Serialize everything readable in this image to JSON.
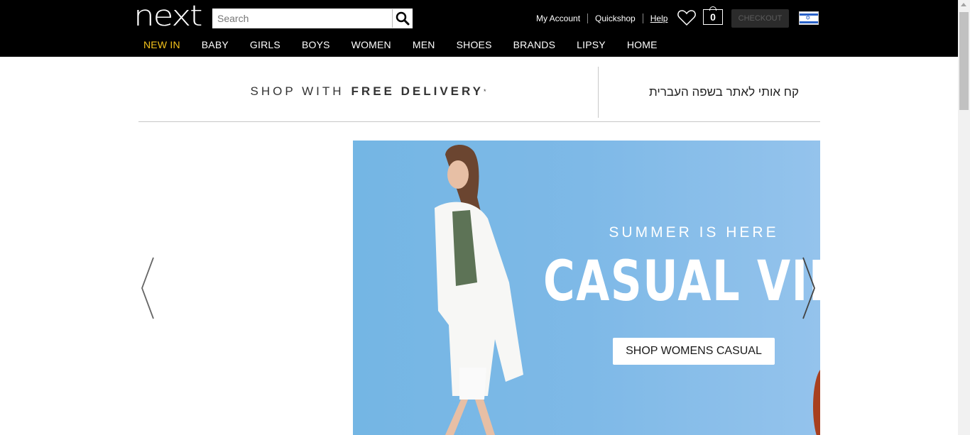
{
  "header": {
    "logo_text": "next",
    "search_placeholder": "Search",
    "links": [
      {
        "label": "My Account"
      },
      {
        "label": "Quickshop"
      },
      {
        "label": "Help"
      }
    ],
    "bag_count": "0",
    "checkout_label": "CHECKOUT",
    "flag": "israel-flag"
  },
  "nav": {
    "items": [
      {
        "label": "NEW IN"
      },
      {
        "label": "BABY"
      },
      {
        "label": "GIRLS"
      },
      {
        "label": "BOYS"
      },
      {
        "label": "WOMEN"
      },
      {
        "label": "MEN"
      },
      {
        "label": "SHOES"
      },
      {
        "label": "BRANDS"
      },
      {
        "label": "LIPSY"
      },
      {
        "label": "HOME"
      }
    ],
    "active_color": "#f3c21b"
  },
  "promo": {
    "prefix": "SHOP WITH",
    "highlight": "FREE DELIVERY",
    "mark": "*",
    "hebrew_link": "קח אותי לאתר בשפה העברית"
  },
  "hero": {
    "subheading": "SUMMER IS HERE",
    "heading": "CASUAL VIBES",
    "cta_label": "SHOP WOMENS CASUAL",
    "background_color": "#7eb9e7"
  }
}
